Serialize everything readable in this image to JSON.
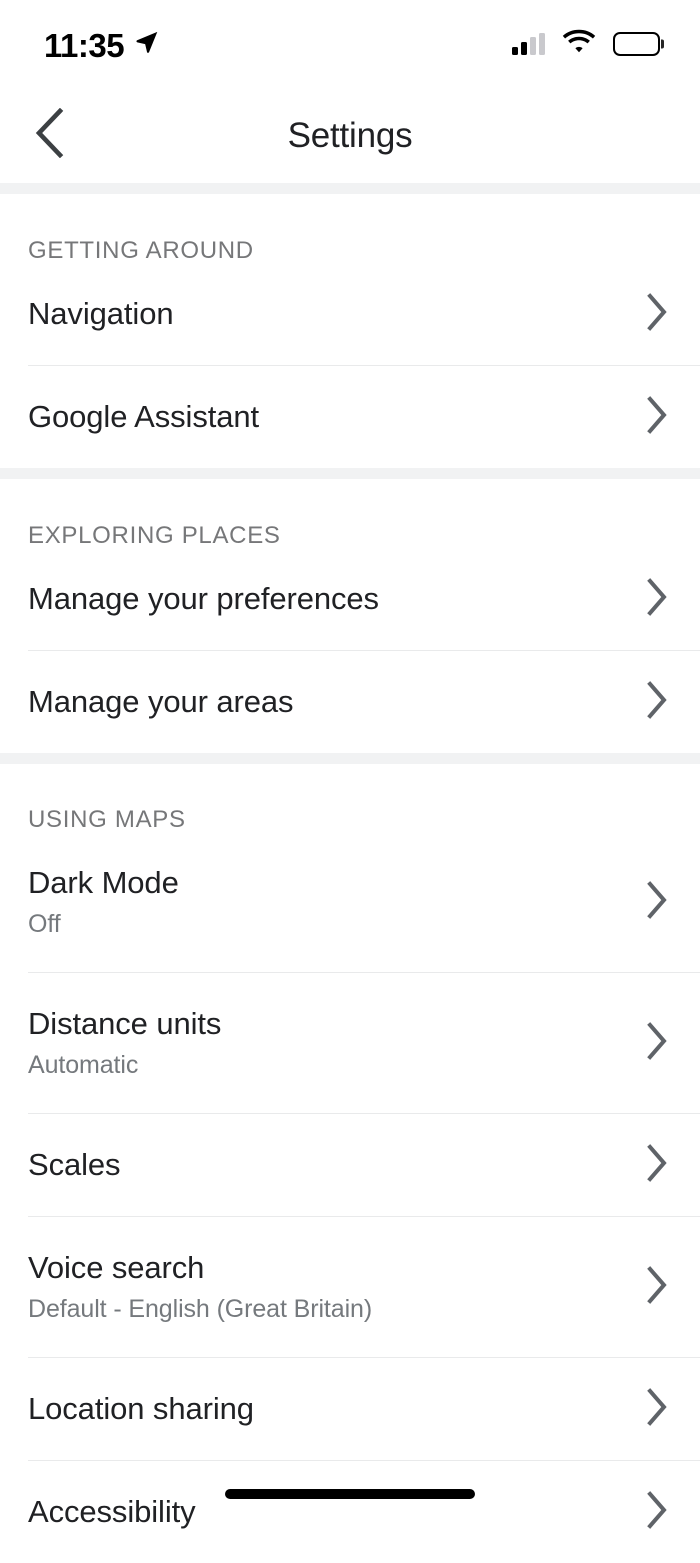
{
  "status_bar": {
    "time": "11:35",
    "location_icon": "location-arrow-icon",
    "signal_icon": "cellular-signal-icon",
    "signal_bars_filled": 2,
    "signal_bars_total": 4,
    "wifi_icon": "wifi-icon",
    "battery_icon": "battery-full-icon"
  },
  "nav": {
    "back_icon": "chevron-left-icon",
    "title": "Settings"
  },
  "colors": {
    "background": "#ffffff",
    "section_gap": "#f1f2f3",
    "divider": "#e9eaeb",
    "primary_text": "#202124",
    "secondary_text": "#75797d",
    "header_text": "#767779",
    "chevron": "#5f6368"
  },
  "sections": [
    {
      "header": "GETTING AROUND",
      "rows": [
        {
          "title": "Navigation",
          "sub": null,
          "chevron": "chevron-right-icon"
        },
        {
          "title": "Google Assistant",
          "sub": null,
          "chevron": "chevron-right-icon"
        }
      ]
    },
    {
      "header": "EXPLORING PLACES",
      "rows": [
        {
          "title": "Manage your preferences",
          "sub": null,
          "chevron": "chevron-right-icon"
        },
        {
          "title": "Manage your areas",
          "sub": null,
          "chevron": "chevron-right-icon"
        }
      ]
    },
    {
      "header": "USING MAPS",
      "rows": [
        {
          "title": "Dark Mode",
          "sub": "Off",
          "chevron": "chevron-right-icon"
        },
        {
          "title": "Distance units",
          "sub": "Automatic",
          "chevron": "chevron-right-icon"
        },
        {
          "title": "Scales",
          "sub": null,
          "chevron": "chevron-right-icon"
        },
        {
          "title": "Voice search",
          "sub": "Default - English (Great Britain)",
          "chevron": "chevron-right-icon"
        },
        {
          "title": "Location sharing",
          "sub": null,
          "chevron": "chevron-right-icon"
        },
        {
          "title": "Accessibility",
          "sub": null,
          "chevron": "chevron-right-icon"
        }
      ]
    }
  ],
  "home_indicator": "home-indicator-bar"
}
